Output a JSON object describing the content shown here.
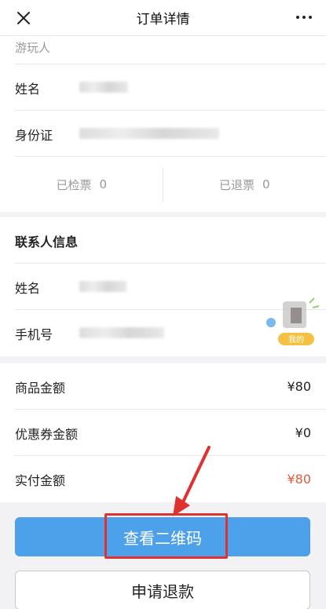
{
  "nav": {
    "title": "订单详情",
    "close_icon": "close-icon",
    "more_icon": "more-icon"
  },
  "visitor": {
    "section_label": "游玩人",
    "name_label": "姓名",
    "id_label": "身份证"
  },
  "tickets": {
    "checked_label": "已检票",
    "checked_count": "0",
    "refunded_label": "已退票",
    "refunded_count": "0"
  },
  "contact": {
    "heading": "联系人信息",
    "name_label": "姓名",
    "phone_label": "手机号"
  },
  "float_badge": {
    "label": "我的"
  },
  "amounts": [
    {
      "label": "商品金额",
      "value": "¥80"
    },
    {
      "label": "优惠券金额",
      "value": "¥0"
    },
    {
      "label": "实付金额",
      "value": "¥80"
    }
  ],
  "buttons": {
    "primary": "查看二维码",
    "secondary": "申请退款"
  },
  "colors": {
    "primary": "#4da1ea",
    "accent_red": "#e4583e",
    "annotation": "#e03131"
  }
}
